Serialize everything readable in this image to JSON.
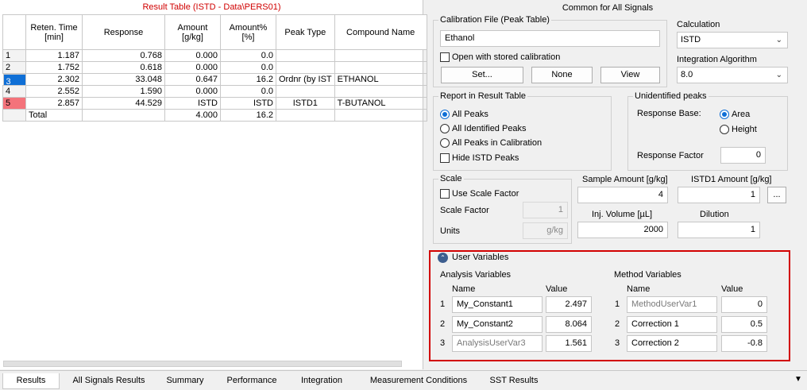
{
  "result_table": {
    "title": "Result Table (ISTD - Data\\PERS01)",
    "columns": [
      "Reten. Time [min]",
      "Response",
      "Amount [g/kg]",
      "Amount% [%]",
      "Peak Type",
      "Compound Name"
    ],
    "rows": [
      {
        "n": "1",
        "rt": "1.187",
        "resp": "0.768",
        "amt": "0.000",
        "pct": "0.0",
        "type": "",
        "name": ""
      },
      {
        "n": "2",
        "rt": "1.752",
        "resp": "0.618",
        "amt": "0.000",
        "pct": "0.0",
        "type": "",
        "name": ""
      },
      {
        "n": "3",
        "rt": "2.302",
        "resp": "33.048",
        "amt": "0.647",
        "pct": "16.2",
        "type": "Ordnr (by IST",
        "name": "ETHANOL"
      },
      {
        "n": "4",
        "rt": "2.552",
        "resp": "1.590",
        "amt": "0.000",
        "pct": "0.0",
        "type": "",
        "name": ""
      },
      {
        "n": "5",
        "rt": "2.857",
        "resp": "44.529",
        "amt": "ISTD",
        "pct": "ISTD",
        "type": "ISTD1",
        "name": "T-BUTANOL"
      }
    ],
    "total": {
      "label": "Total",
      "amt": "4.000",
      "pct": "16.2"
    }
  },
  "common": {
    "title": "Common for All Signals",
    "calibration": {
      "label": "Calibration File (Peak Table)",
      "value": "Ethanol",
      "open_stored": "Open with stored calibration",
      "set_btn": "Set...",
      "none_btn": "None",
      "view_btn": "View"
    },
    "calculation": {
      "label": "Calculation",
      "value": "ISTD"
    },
    "integration": {
      "label": "Integration Algorithm",
      "value": "8.0"
    },
    "report": {
      "label": "Report in Result Table",
      "all_peaks": "All Peaks",
      "all_identified": "All Identified Peaks",
      "all_in_calibration": "All Peaks in Calibration",
      "hide_istd": "Hide ISTD Peaks"
    },
    "unidentified": {
      "label": "Unidentified peaks",
      "response_base": "Response Base:",
      "area": "Area",
      "height": "Height",
      "response_factor_label": "Response Factor",
      "response_factor_value": "0"
    },
    "scale": {
      "label": "Scale",
      "use_scale": "Use Scale Factor",
      "factor_label": "Scale Factor",
      "factor_value": "1",
      "units_label": "Units",
      "units_value": "g/kg"
    },
    "sample_amount": {
      "label": "Sample Amount [g/kg]",
      "value": "4"
    },
    "istd1_amount": {
      "label": "ISTD1 Amount [g/kg]",
      "value": "1",
      "more_btn": "..."
    },
    "inj_volume": {
      "label": "Inj. Volume [µL]",
      "value": "2000"
    },
    "dilution": {
      "label": "Dilution",
      "value": "1"
    }
  },
  "user_variables": {
    "title": "User Variables",
    "analysis": {
      "label": "Analysis Variables",
      "name_header": "Name",
      "value_header": "Value",
      "rows": [
        {
          "n": "1",
          "name": "My_Constant1",
          "value": "2.497"
        },
        {
          "n": "2",
          "name": "My_Constant2",
          "value": "8.064"
        },
        {
          "n": "3",
          "name": "AnalysisUserVar3",
          "value": "1.561"
        }
      ]
    },
    "method": {
      "label": "Method Variables",
      "name_header": "Name",
      "value_header": "Value",
      "rows": [
        {
          "n": "1",
          "name": "MethodUserVar1",
          "value": "0"
        },
        {
          "n": "2",
          "name": "Correction 1",
          "value": "0.5"
        },
        {
          "n": "3",
          "name": "Correction 2",
          "value": "-0.8"
        }
      ]
    }
  },
  "tabs": [
    "Results",
    "All Signals Results",
    "Summary",
    "Performance",
    "Integration",
    "Measurement Conditions",
    "SST Results"
  ],
  "colors": {
    "accent": "#0f6fd6",
    "istd_row": "#f4737b",
    "highlight_frame": "#d20000",
    "title_red": "#d00000"
  }
}
